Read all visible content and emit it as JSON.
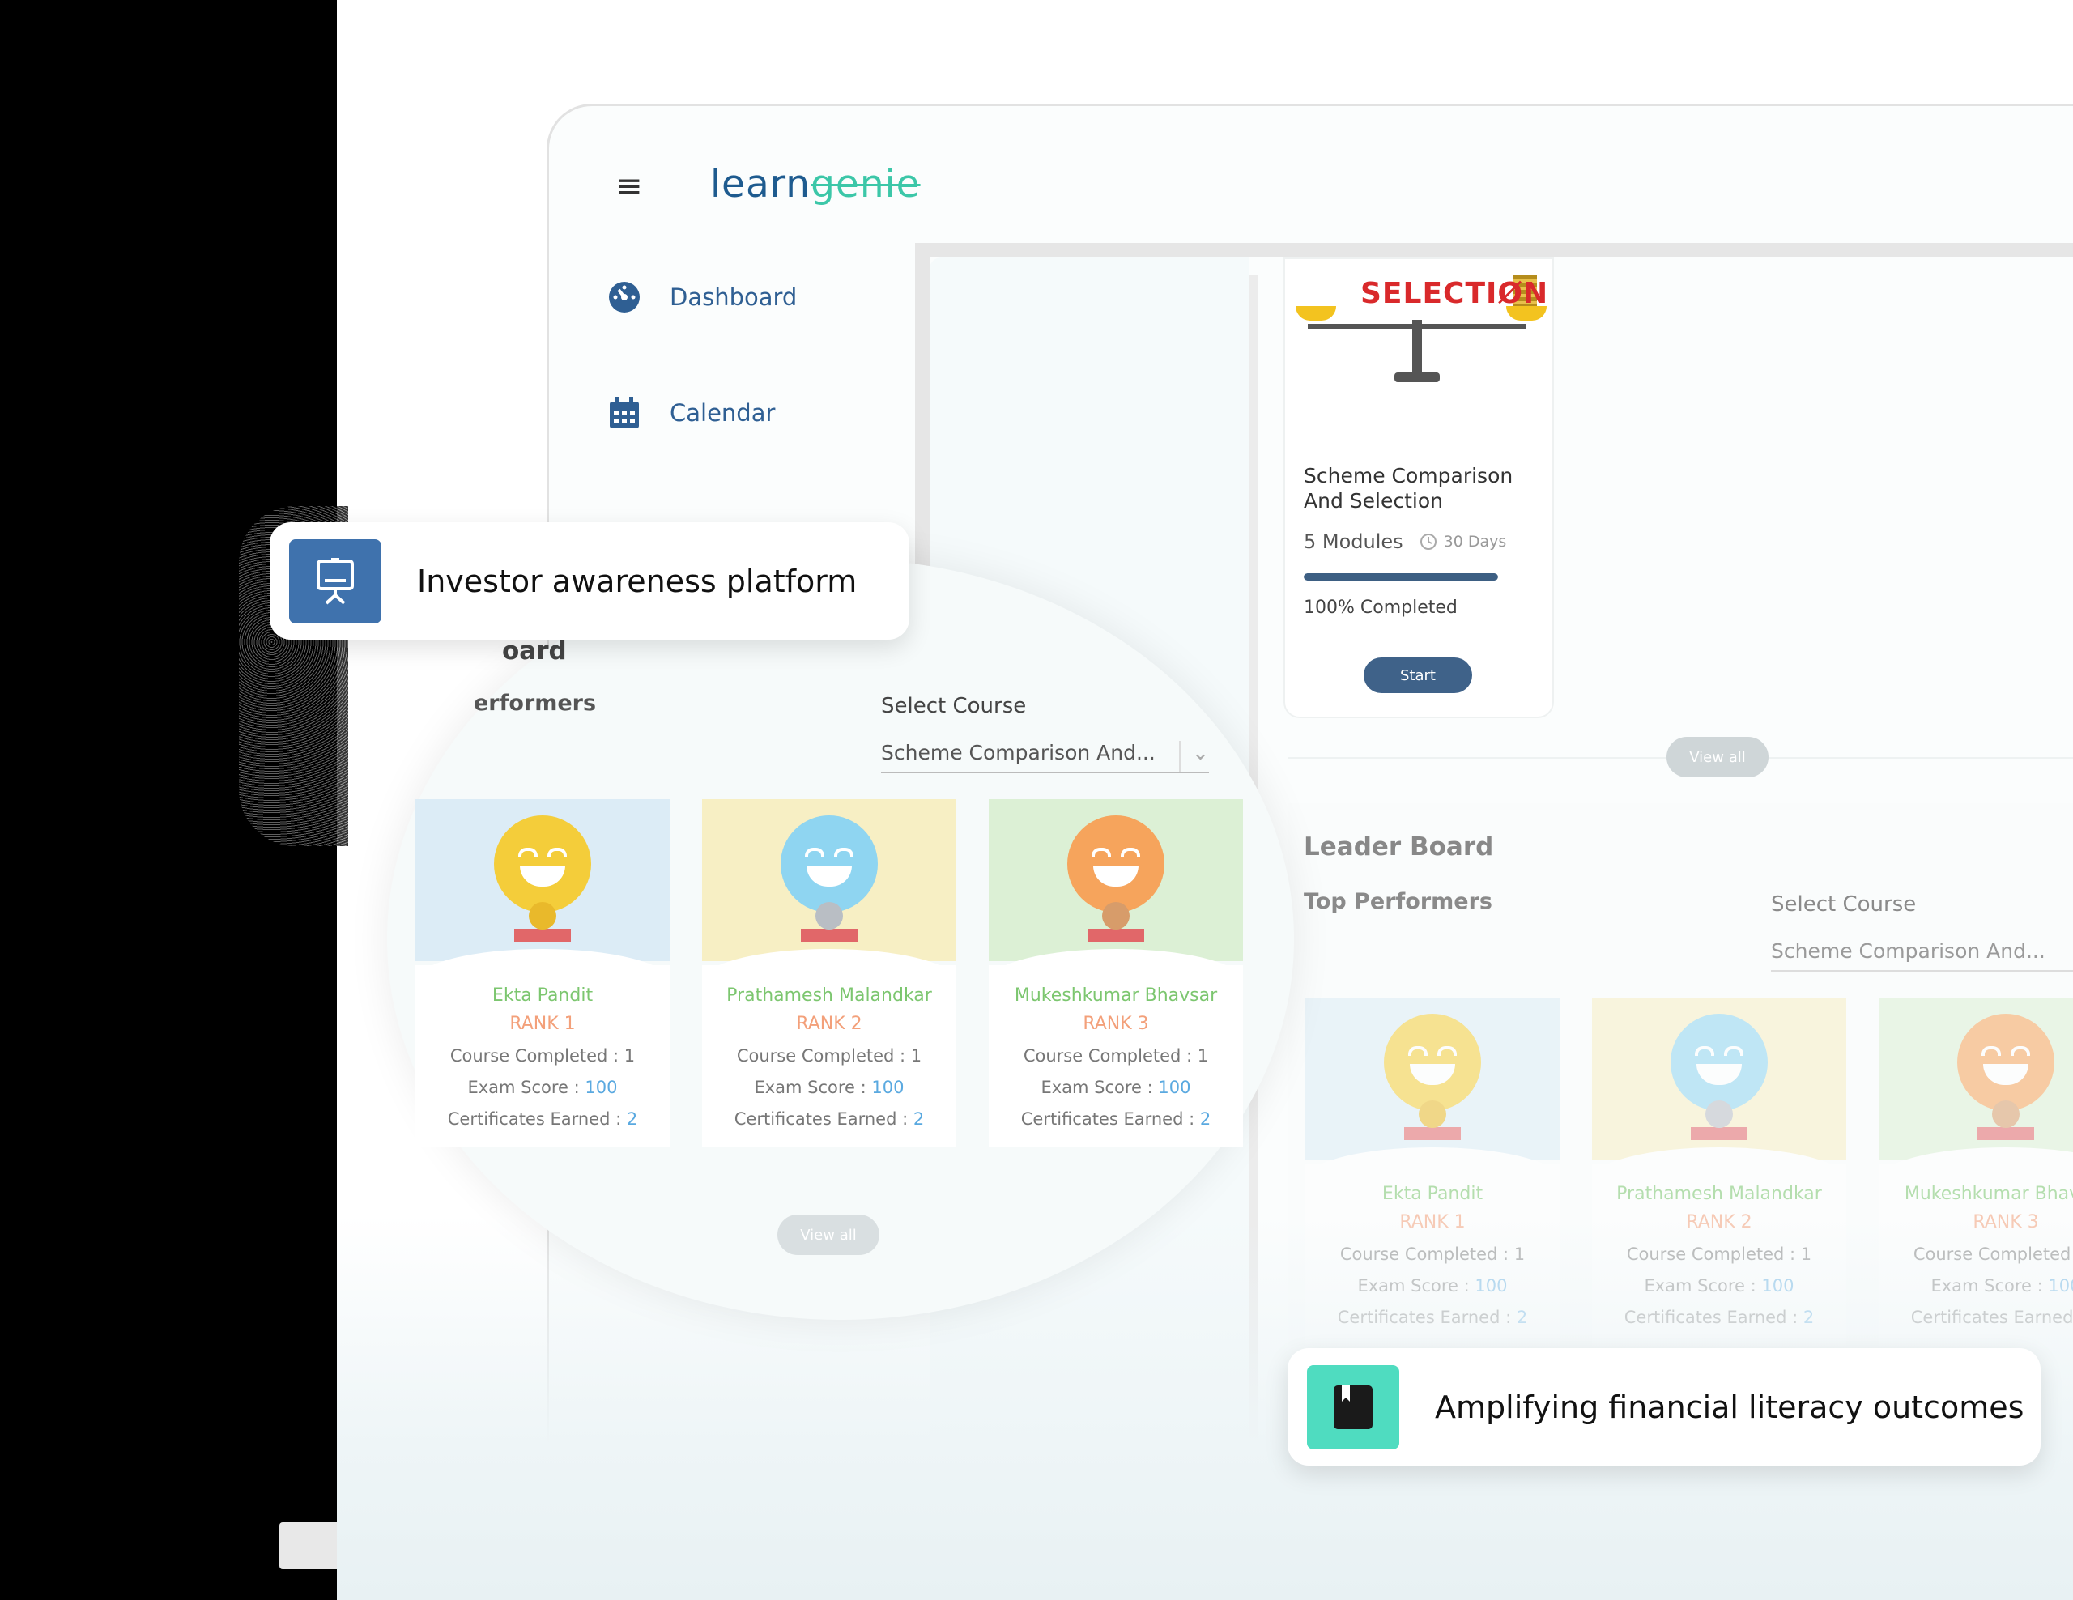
{
  "app": {
    "logo_part1": "learn",
    "logo_part2": "genie",
    "menu_icon": "hamburger-icon"
  },
  "sidebar": {
    "items": [
      {
        "label": "Dashboard",
        "icon": "dashboard-gauge-icon"
      },
      {
        "label": "Calendar",
        "icon": "calendar-icon"
      }
    ]
  },
  "course": {
    "image_title": "SELECTIØN",
    "title": "Scheme Comparison And Selection",
    "modules": "5 Modules",
    "days": "30 Days",
    "progress": 1.0,
    "progress_text": "100% Completed",
    "start_label": "Start",
    "view_all_label": "View all"
  },
  "leaderboard": {
    "title": "Leader Board",
    "subtitle": "Top Performers",
    "select_label": "Select Course",
    "select_value": "Scheme Comparison And...",
    "view_all_label": "View all",
    "performers": [
      {
        "name": "Ekta Pandit",
        "rank": "RANK 1",
        "course_label": "Course Completed : ",
        "course_value": "1",
        "exam_label": "Exam Score : ",
        "exam_value": "100",
        "cert_label": "Certificates Earned : ",
        "cert_value": "2",
        "bg": "#dcecf6",
        "face": "#f4cd3a",
        "medal": "#e9b92b"
      },
      {
        "name": "Prathamesh Malandkar",
        "rank": "RANK 2",
        "course_label": "Course Completed : ",
        "course_value": "1",
        "exam_label": "Exam Score : ",
        "exam_value": "100",
        "cert_label": "Certificates Earned : ",
        "cert_value": "2",
        "bg": "#f7efc4",
        "face": "#8fd5f1",
        "medal": "#b9bec4"
      },
      {
        "name": "Mukeshkumar Bhavsar",
        "rank": "RANK 3",
        "course_label": "Course Completed : ",
        "course_value": "1",
        "exam_label": "Exam Score : ",
        "exam_value": "100",
        "cert_label": "Certificates Earned : ",
        "cert_value": "2",
        "bg": "#dcf0d5",
        "face": "#f6a45c",
        "medal": "#d79c6a"
      }
    ]
  },
  "magnified": {
    "title": "oard",
    "subtitle": "erformers"
  },
  "callouts": [
    {
      "text": "Investor awareness platform",
      "icon": "presentation-board-icon",
      "color": "#3f72ad"
    },
    {
      "text": "Amplifying financial literacy outcomes",
      "icon": "book-icon",
      "color": "#4fdcc0"
    }
  ]
}
